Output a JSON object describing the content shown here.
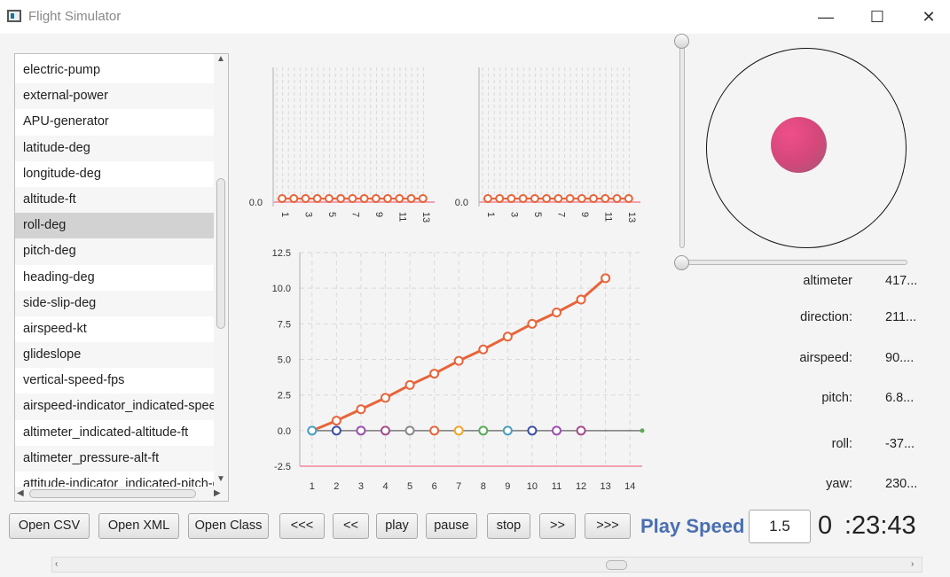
{
  "window": {
    "title": "Flight Simulator",
    "controls": {
      "minimize": "—",
      "maximize": "☐",
      "close": "✕"
    }
  },
  "attributes": {
    "selected_index": 6,
    "items": [
      "electric-pump",
      "external-power",
      "APU-generator",
      "latitude-deg",
      "longitude-deg",
      "altitude-ft",
      "roll-deg",
      "pitch-deg",
      "heading-deg",
      "side-slip-deg",
      "airspeed-kt",
      "glideslope",
      "vertical-speed-fps",
      "airspeed-indicator_indicated-speed-kt",
      "altimeter_indicated-altitude-ft",
      "altimeter_pressure-alt-ft",
      "attitude-indicator_indicated-pitch-deg"
    ]
  },
  "chart_data": [
    {
      "type": "line",
      "x": [
        1,
        2,
        3,
        4,
        5,
        6,
        7,
        8,
        9,
        10,
        11,
        12,
        13
      ],
      "x_tick_labels": [
        "1",
        "3",
        "5",
        "7",
        "9",
        "11",
        "13"
      ],
      "y_tick_labels": [
        "0.0"
      ],
      "series": [
        {
          "values": [
            0,
            0,
            0,
            0,
            0,
            0,
            0,
            0,
            0,
            0,
            0,
            0,
            0
          ],
          "color": "#e8643a"
        }
      ]
    },
    {
      "type": "line",
      "x": [
        1,
        2,
        3,
        4,
        5,
        6,
        7,
        8,
        9,
        10,
        11,
        12,
        13
      ],
      "x_tick_labels": [
        "1",
        "3",
        "5",
        "7",
        "9",
        "11",
        "13"
      ],
      "y_tick_labels": [
        "0.0"
      ],
      "series": [
        {
          "values": [
            0,
            0,
            0,
            0,
            0,
            0,
            0,
            0,
            0,
            0,
            0,
            0,
            0
          ],
          "color": "#e8643a"
        }
      ]
    },
    {
      "type": "line",
      "xlim": [
        0.5,
        14.5
      ],
      "ylim": [
        -2.5,
        12.5
      ],
      "x_tick_labels": [
        "1",
        "2",
        "3",
        "4",
        "5",
        "6",
        "7",
        "8",
        "9",
        "10",
        "11",
        "12",
        "13",
        "14"
      ],
      "y_tick_labels": [
        "-2.5",
        "0.0",
        "2.5",
        "5.0",
        "7.5",
        "10.0",
        "12.5"
      ],
      "line": {
        "color": "#e8643a",
        "x": [
          1,
          2,
          3,
          4,
          5,
          6,
          7,
          8,
          9,
          10,
          11,
          12,
          13
        ],
        "values": [
          -0.2,
          0.7,
          1.5,
          2.3,
          3.2,
          4.0,
          4.9,
          5.7,
          6.6,
          7.5,
          8.3,
          9.2,
          10.7
        ]
      },
      "points": {
        "x": [
          1,
          2,
          3,
          4,
          5,
          6,
          7,
          8,
          9,
          10,
          11,
          12
        ],
        "values": [
          0,
          0,
          0,
          0,
          0,
          0,
          0,
          0,
          0,
          0,
          0,
          0
        ],
        "colors": [
          "#4a9ec1",
          "#3b4fa8",
          "#9a4fb1",
          "#a64b8b",
          "#8a8a8a",
          "#e8643a",
          "#f0a42a",
          "#5aaa5a",
          "#4a9ec1",
          "#3b4fa8",
          "#9a4fb1",
          "#a64b8b",
          "#8a8a8a"
        ]
      },
      "baseline_color": "#7a7a7a",
      "limit_color": "#f5a0b0"
    }
  ],
  "gauges": [
    {
      "label": "altimeter",
      "value": "417..."
    },
    {
      "label": "direction:",
      "value": "211..."
    },
    {
      "label": "airspeed:",
      "value": "90...."
    },
    {
      "label": "pitch:",
      "value": "6.8..."
    },
    {
      "label": "roll:",
      "value": "-37..."
    },
    {
      "label": "yaw:",
      "value": "230..."
    }
  ],
  "buttons": {
    "open_csv": "Open CSV",
    "open_xml": "Open XML",
    "open_class": "Open Class",
    "rewind_far": "<<<",
    "rewind": "<<",
    "play": "play",
    "pause": "pause",
    "stop": "stop",
    "forward": ">>",
    "forward_far": ">>>"
  },
  "playback": {
    "speed_label": "Play Speed",
    "speed_value": "1.5",
    "time_hours": "0",
    "time_rest": ":23:43"
  }
}
